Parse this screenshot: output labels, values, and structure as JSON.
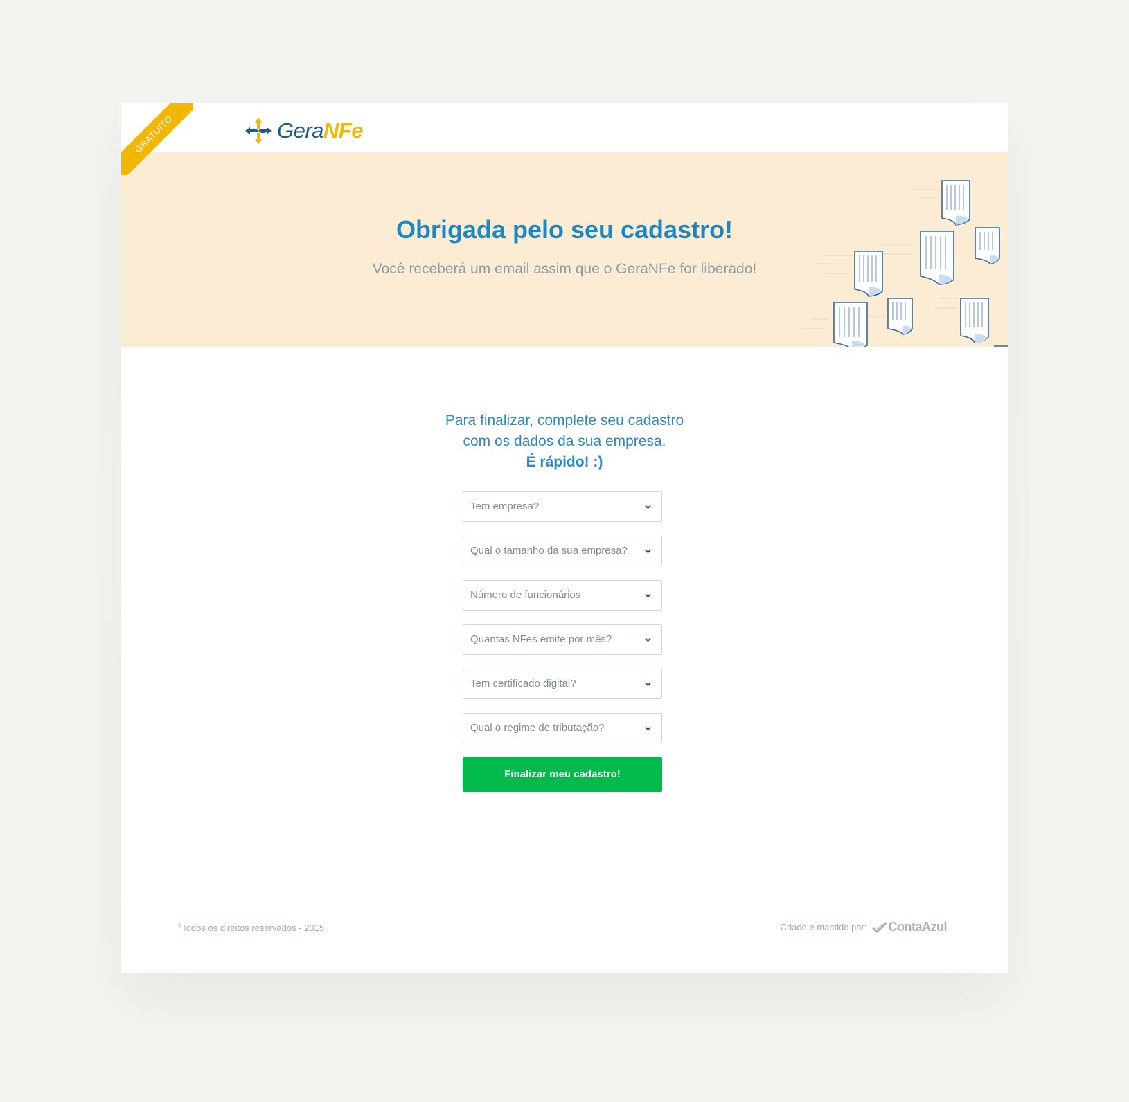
{
  "badge": "GRATUITO",
  "logo": {
    "part1": "Gera",
    "part2": "NFe"
  },
  "hero": {
    "title": "Obrigada pelo seu cadastro!",
    "subtitle": "Você receberá um email assim que o GeraNFe for liberado!"
  },
  "intro": {
    "line1": "Para finalizar, complete seu cadastro",
    "line2": "com os dados da sua empresa.",
    "line3": "É rápido! :)"
  },
  "form": {
    "selects": [
      "Tem empresa?",
      "Qual o tamanho da sua empresa?",
      "Número de funcionários",
      "Quantas NFes emite por mês?",
      "Tem certificado digital?",
      "Qual o regime de tributação?"
    ],
    "submit": "Finalizar meu cadastro!"
  },
  "footer": {
    "copyright_mark": "©",
    "copyright": "Todos os direitos reservados - 2015",
    "made_by": "Criado e mantido por:",
    "partner": "ContaAzul"
  },
  "colors": {
    "primary_blue": "#1d87c4",
    "brand_yellow": "#f2b705",
    "hero_bg": "#fdecd4",
    "button_green": "#00ba4c"
  },
  "icons": {
    "logo": "geranfe-arrows-icon",
    "dropdown": "chevron-down-icon",
    "partner": "contaazul-check-icon",
    "illustration": "document-icon"
  }
}
